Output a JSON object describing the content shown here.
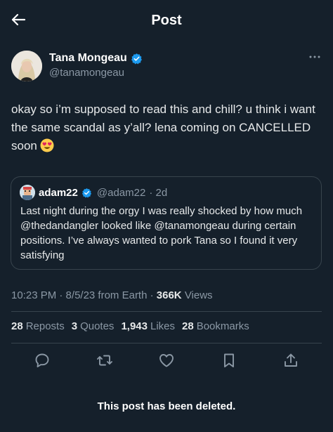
{
  "header": {
    "title": "Post",
    "back_icon": "arrow-left-icon"
  },
  "author": {
    "name": "Tana Mongeau",
    "handle": "@tanamongeau",
    "verified": true,
    "more_icon": "more-horizontal-icon"
  },
  "post": {
    "text": "okay so i’m supposed to read this and chill? u think i want the same scandal as y’all? lena coming on CANCELLED soon",
    "emoji": "heart-eyes-emoji"
  },
  "quote": {
    "name": "adam22",
    "handle": "@adam22",
    "time": "· 2d",
    "text": "Last night during the orgy I was really shocked by how much @thedandangler looked like @tanamongeau during certain positions. I’ve always wanted to pork Tana so I found it very satisfying"
  },
  "meta": {
    "time": "10:23 PM",
    "date_source": "· 8/5/23 from Earth ·",
    "views_count": "366K",
    "views_label": "Views"
  },
  "stats": {
    "reposts": {
      "count": "28",
      "label": "Reposts"
    },
    "quotes": {
      "count": "3",
      "label": "Quotes"
    },
    "likes": {
      "count": "1,943",
      "label": "Likes"
    },
    "bookmarks": {
      "count": "28",
      "label": "Bookmarks"
    }
  },
  "actions": [
    "reply-icon",
    "repost-icon",
    "like-icon",
    "bookmark-icon",
    "share-icon"
  ],
  "deleted_notice": "This post has been deleted.",
  "colors": {
    "background": "#15202b",
    "text": "#e7e9ea",
    "muted": "#8b98a5",
    "border": "#38444d",
    "verified": "#1d9bf0"
  }
}
